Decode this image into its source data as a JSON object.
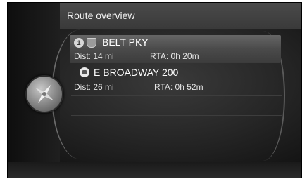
{
  "header": {
    "title": "Route overview"
  },
  "compass": {
    "icon": "compass-icon"
  },
  "routes": [
    {
      "name": "BELT PKY",
      "distance": "Dist: 14 mi",
      "rta": "RTA: 0h 20m",
      "badge": "1",
      "icon": "highway-shield-icon",
      "selected": true
    },
    {
      "name": "E BROADWAY 200",
      "distance": "Dist: 26 mi",
      "rta": "RTA: 0h 52m",
      "icon": "destination-icon",
      "selected": false
    }
  ],
  "colors": {
    "background": "#262626",
    "header": "#454545",
    "selection": "#555555",
    "text": "#ffffff"
  }
}
